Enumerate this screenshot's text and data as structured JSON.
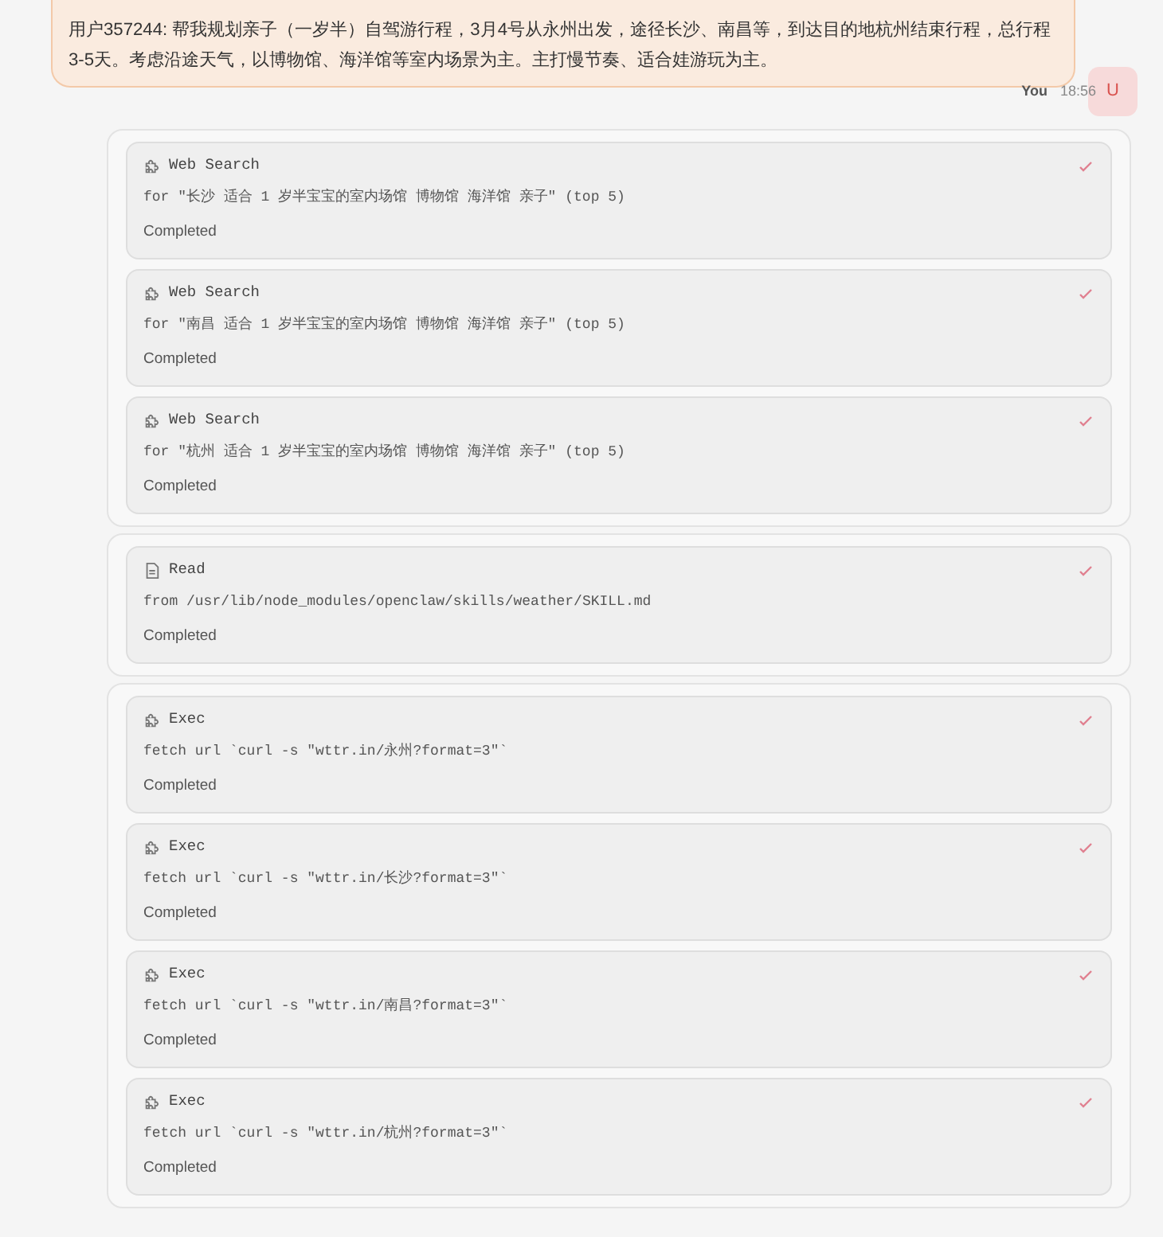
{
  "message": {
    "text": "用户357244: 帮我规划亲子（一岁半）自驾游行程，3月4号从永州出发，途径长沙、南昌等，到达目的地杭州结束行程，总行程3-5天。考虑沿途天气，以博物馆、海洋馆等室内场景为主。主打慢节奏、适合娃游玩为主。",
    "sender": "You",
    "time": "18:56",
    "avatar": "U"
  },
  "tool_groups": [
    {
      "tools": [
        {
          "kind": "search",
          "name": "Web Search",
          "detail": "for \"长沙 适合 1 岁半宝宝的室内场馆 博物馆 海洋馆 亲子\" (top 5)",
          "status": "Completed",
          "done": true
        },
        {
          "kind": "search",
          "name": "Web Search",
          "detail": "for \"南昌 适合 1 岁半宝宝的室内场馆 博物馆 海洋馆 亲子\" (top 5)",
          "status": "Completed",
          "done": true
        },
        {
          "kind": "search",
          "name": "Web Search",
          "detail": "for \"杭州 适合 1 岁半宝宝的室内场馆 博物馆 海洋馆 亲子\" (top 5)",
          "status": "Completed",
          "done": true
        }
      ]
    },
    {
      "tools": [
        {
          "kind": "read",
          "name": "Read",
          "detail": "from /usr/lib/node_modules/openclaw/skills/weather/SKILL.md",
          "status": "Completed",
          "done": true
        }
      ]
    },
    {
      "tools": [
        {
          "kind": "exec",
          "name": "Exec",
          "detail": "fetch url `curl -s \"wttr.in/永州?format=3\"`",
          "status": "Completed",
          "done": true
        },
        {
          "kind": "exec",
          "name": "Exec",
          "detail": "fetch url `curl -s \"wttr.in/长沙?format=3\"`",
          "status": "Completed",
          "done": true
        },
        {
          "kind": "exec",
          "name": "Exec",
          "detail": "fetch url `curl -s \"wttr.in/南昌?format=3\"`",
          "status": "Completed",
          "done": true
        },
        {
          "kind": "exec",
          "name": "Exec",
          "detail": "fetch url `curl -s \"wttr.in/杭州?format=3\"`",
          "status": "Completed",
          "done": true
        }
      ]
    }
  ]
}
